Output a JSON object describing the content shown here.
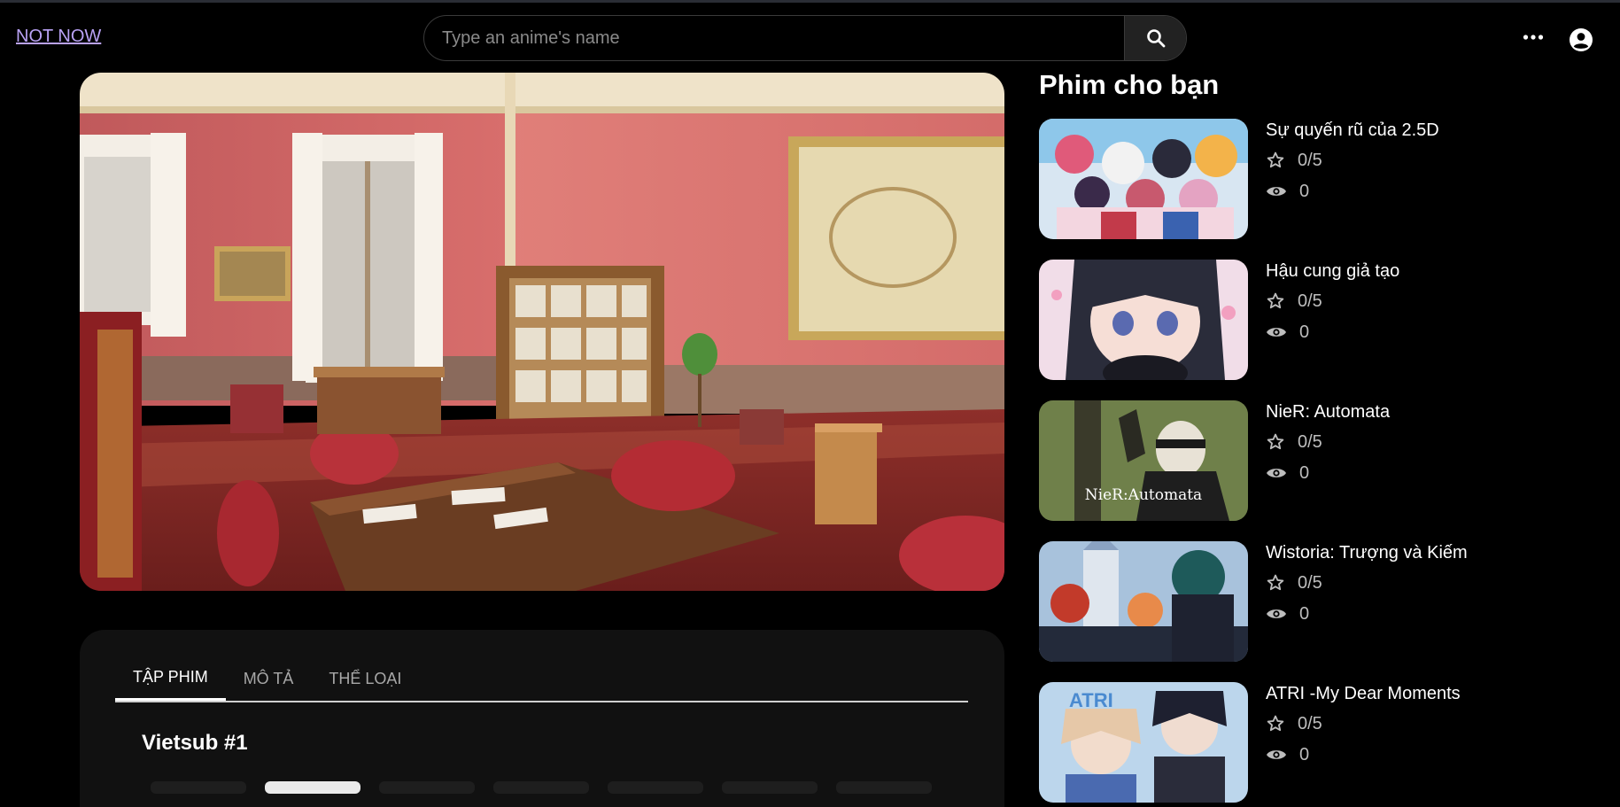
{
  "header": {
    "not_now": "NOT NOW",
    "search_placeholder": "Type an anime's name",
    "search_value": "",
    "icons": [
      "search-icon",
      "more-horizontal-icon",
      "account-circle-icon"
    ]
  },
  "player": {
    "scene": "video-frame"
  },
  "tabs": [
    {
      "label": "TẬP PHIM",
      "active": true
    },
    {
      "label": "MÔ TẢ",
      "active": false
    },
    {
      "label": "THỂ LOẠI",
      "active": false
    }
  ],
  "episodes": {
    "group_title": "Vietsub #1"
  },
  "recommendations": {
    "title": "Phim cho bạn",
    "items": [
      {
        "name": "Sự quyến rũ của 2.5D",
        "rating": "0/5",
        "views": "0"
      },
      {
        "name": "Hậu cung giả tạo",
        "rating": "0/5",
        "views": "0"
      },
      {
        "name": "NieR: Automata",
        "rating": "0/5",
        "views": "0",
        "thumb_text": "NieR:Automata"
      },
      {
        "name": "Wistoria: Trượng và Kiếm",
        "rating": "0/5",
        "views": "0"
      },
      {
        "name": "ATRI -My Dear Moments",
        "rating": "0/5",
        "views": "0",
        "thumb_text": "ATRI"
      }
    ]
  },
  "colors": {
    "background": "#000000",
    "link": "#b9a2f5",
    "panel": "#111111",
    "muted_text": "#bdbdbd"
  }
}
